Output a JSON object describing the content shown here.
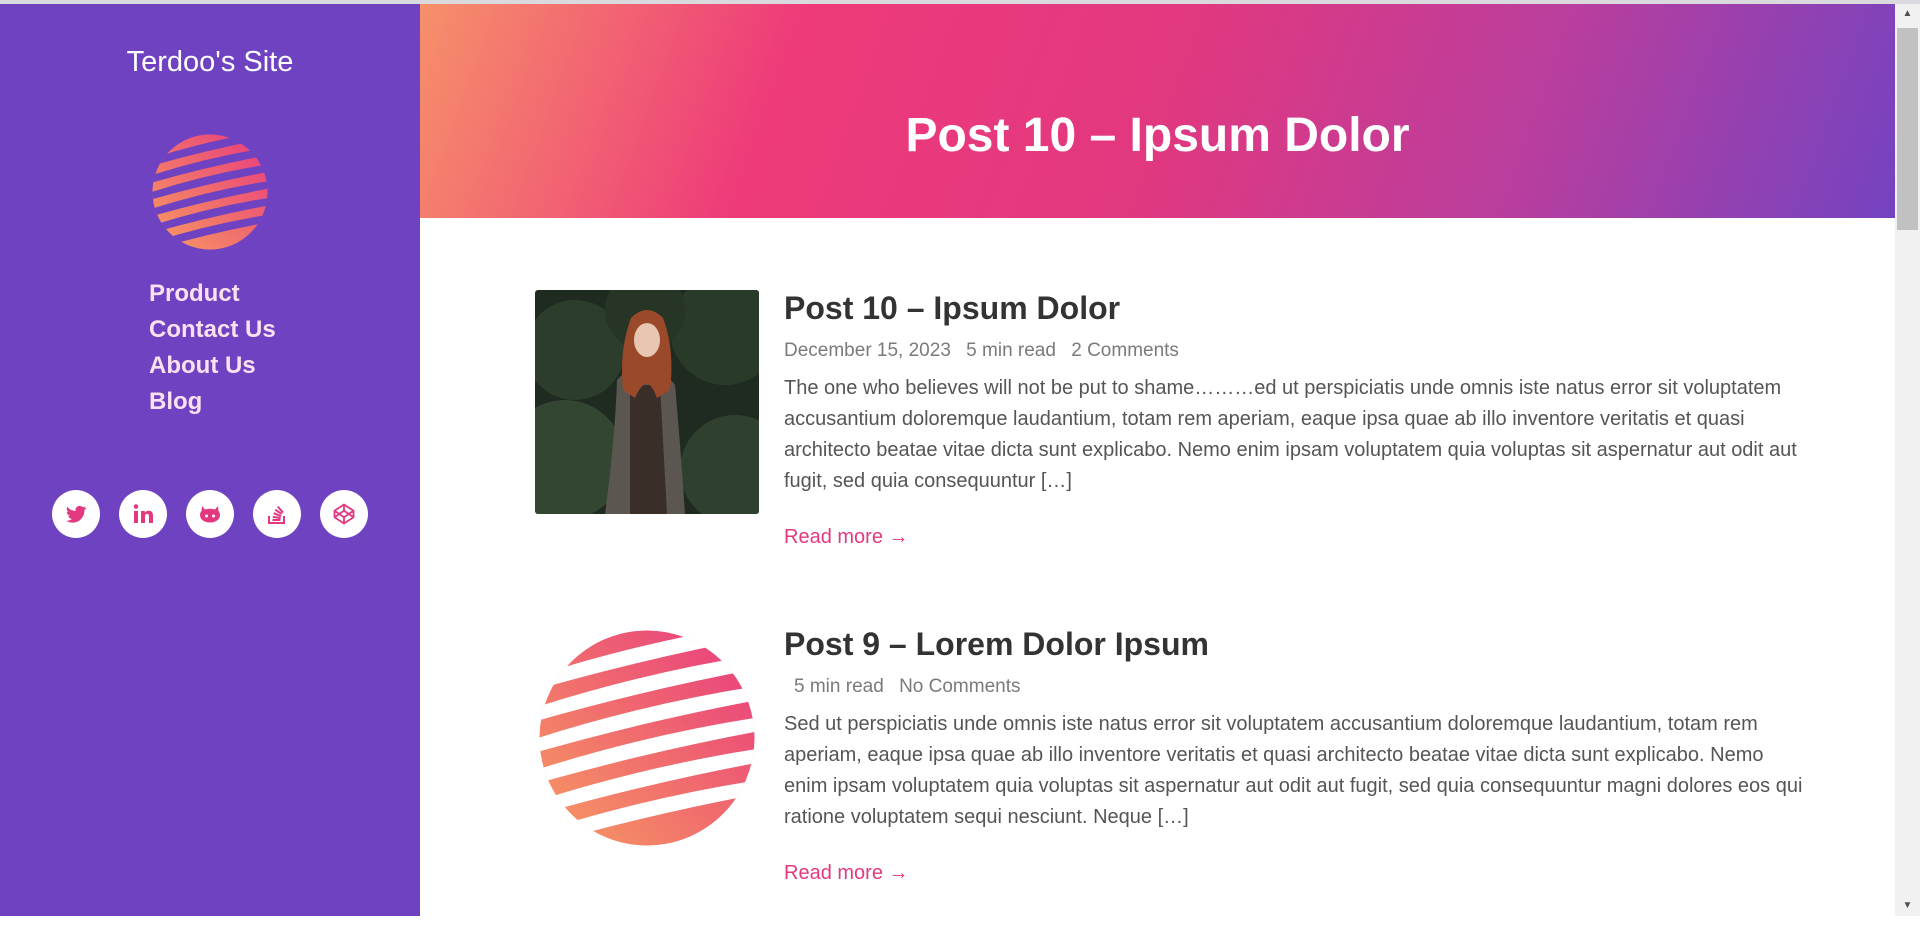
{
  "sidebar": {
    "site_title": "Terdoo's Site",
    "nav": [
      "Product",
      "Contact Us",
      "About Us",
      "Blog"
    ],
    "socials": [
      "twitter-icon",
      "linkedin-icon",
      "github-icon",
      "stackoverflow-icon",
      "codepen-icon"
    ]
  },
  "hero": {
    "title": "Post 10 – Ipsum Dolor"
  },
  "posts": [
    {
      "title": "Post 10 – Ipsum Dolor",
      "date": "December 15, 2023",
      "read_time": "5 min read",
      "comments": "2 Comments",
      "excerpt": "The one who believes will not be put to shame………ed ut perspiciatis unde omnis iste natus error sit voluptatem accusantium doloremque laudantium, totam rem aperiam, eaque ipsa quae ab illo inventore veritatis et quasi architecto beatae vitae dicta sunt explicabo. Nemo enim ipsam voluptatem quia voluptas sit aspernatur aut odit aut fugit, sed quia consequuntur […]",
      "read_more": "Read more →",
      "thumbnail": "photo-thumbnail"
    },
    {
      "title": "Post 9 – Lorem Dolor Ipsum",
      "date": "",
      "read_time": "5 min read",
      "comments": "No Comments",
      "excerpt": "Sed ut perspiciatis unde omnis iste natus error sit voluptatem accusantium doloremque laudantium, totam rem aperiam, eaque ipsa quae ab illo inventore veritatis et quasi architecto beatae vitae dicta sunt explicabo. Nemo enim ipsam voluptatem quia voluptas sit aspernatur aut odit aut fugit, sed quia consequuntur magni dolores eos qui ratione voluptatem sequi nesciunt. Neque […]",
      "read_more": "Read more →",
      "thumbnail": "globe-logo"
    }
  ],
  "colors": {
    "sidebar_bg": "#6f42c1",
    "accent": "#e2387f",
    "gradient_start": "#f6906a",
    "gradient_end": "#7443c1"
  }
}
